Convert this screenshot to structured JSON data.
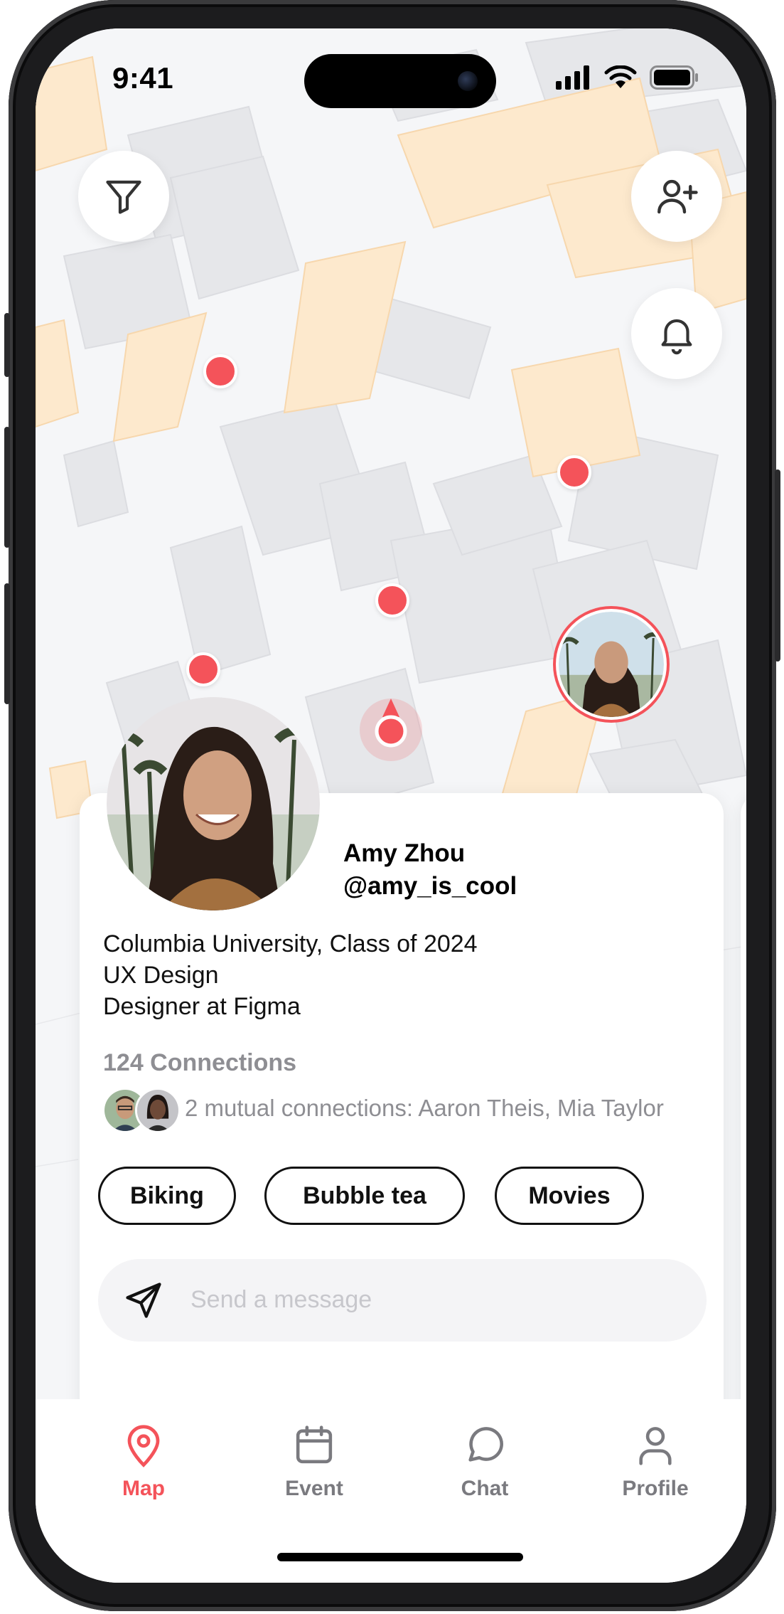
{
  "status_bar": {
    "time": "9:41"
  },
  "colors": {
    "accent": "#f4535a",
    "muted": "#8e8e93",
    "inactive_tab": "#7a7a7f"
  },
  "map_controls": {
    "filter_icon": "filter-icon",
    "add_friend_icon": "person-plus-icon",
    "notifications_icon": "bell-icon"
  },
  "profile": {
    "name": "Amy Zhou",
    "handle": "@amy_is_cool",
    "school": "Columbia University, Class of 2024",
    "major": "UX Design",
    "job": "Designer at Figma",
    "connections": "124 Connections",
    "mutual": "2 mutual connections: Aaron Theis, Mia Taylor",
    "interests": [
      "Biking",
      "Bubble tea",
      "Movies"
    ]
  },
  "message": {
    "placeholder": "Send a message"
  },
  "tabs": [
    {
      "label": "Map",
      "icon": "map-pin-icon",
      "active": true
    },
    {
      "label": "Event",
      "icon": "calendar-icon",
      "active": false
    },
    {
      "label": "Chat",
      "icon": "chat-bubble-icon",
      "active": false
    },
    {
      "label": "Profile",
      "icon": "user-icon",
      "active": false
    }
  ]
}
